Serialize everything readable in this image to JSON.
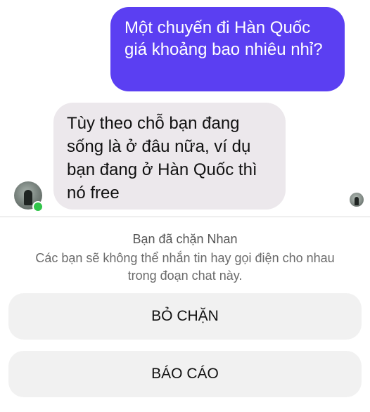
{
  "conversation": {
    "sent_message": "Một chuyến đi Hàn Quốc giá khoảng bao nhiêu nhỉ?",
    "received_message": "Tùy theo chỗ bạn đang sống là ở đâu nữa, ví dụ bạn đang ở Hàn Quốc thì nó free"
  },
  "contact": {
    "avatar_icon": "person-avatar-icon",
    "online": true,
    "online_color": "#31c44a"
  },
  "theme": {
    "sent_bubble_color": "#5b3ff2",
    "received_bubble_color": "#ece8ec"
  },
  "block_notice": {
    "title": "Bạn đã chặn Nhan",
    "description": "Các bạn sẽ không thể nhắn tin hay gọi điện cho nhau trong đoạn chat này.",
    "unblock_label": "BỎ CHẶN",
    "report_label": "BÁO CÁO"
  }
}
